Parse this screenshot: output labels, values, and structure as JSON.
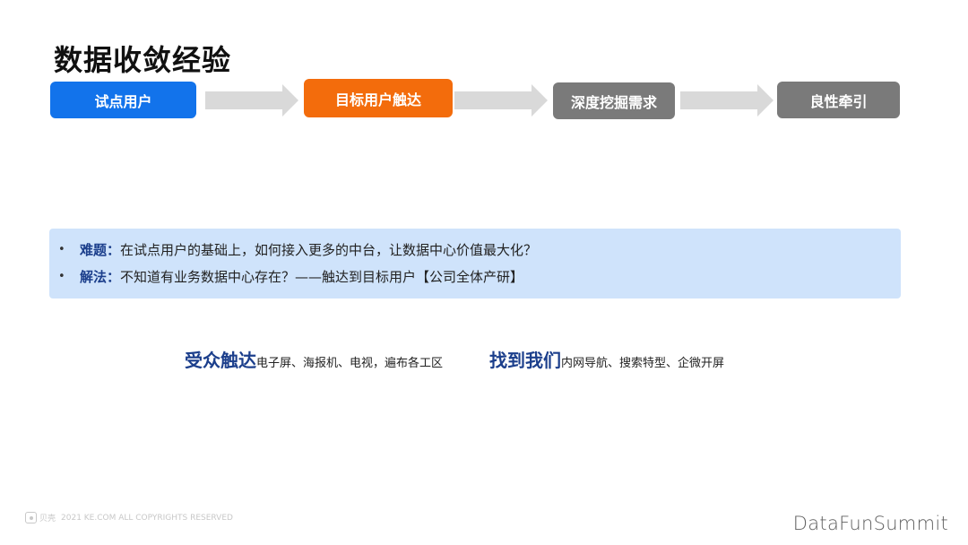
{
  "title": "数据收敛经验",
  "flow": {
    "steps": [
      {
        "label": "试点用户",
        "color": "#1273eb"
      },
      {
        "label": "目标用户触达",
        "color": "#f36c0c"
      },
      {
        "label": "深度挖掘需求",
        "color": "#7a7a7a"
      },
      {
        "label": "良性牵引",
        "color": "#7a7a7a"
      }
    ],
    "arrow_color": "#d9d9d9"
  },
  "callout": {
    "bullet": "•",
    "difficulty_label": "难题：",
    "difficulty_text": "在试点用户的基础上，如何接入更多的中台，让数据中心价值最大化？",
    "solution_label": "解法：",
    "solution_text": "不知道有业务数据中心存在？——触达到目标用户【公司全体产研】"
  },
  "channels": [
    {
      "keyword": "受众触达",
      "desc": "电子屏、海报机、电视，遍布各工区"
    },
    {
      "keyword": "找到我们",
      "desc": "内网导航、搜索特型、企微开屏"
    }
  ],
  "footer": {
    "logo_text": "贝壳",
    "copyright": "2021 KE.COM ALL COPYRIGHTS  RESERVED",
    "brand": "DataFunSummit"
  }
}
